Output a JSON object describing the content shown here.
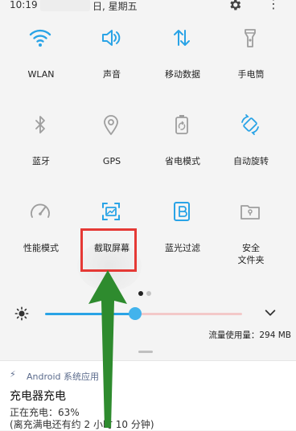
{
  "status_bar": {
    "time": "10:19",
    "date": "日, 星期五"
  },
  "tiles": [
    {
      "id": "wlan",
      "label": "WLAN",
      "icon": "wifi-icon",
      "active": true
    },
    {
      "id": "sound",
      "label": "声音",
      "icon": "speaker-icon",
      "active": true
    },
    {
      "id": "mobile-data",
      "label": "移动数据",
      "icon": "data-arrows-icon",
      "active": true
    },
    {
      "id": "flashlight",
      "label": "手电筒",
      "icon": "flashlight-icon",
      "active": false
    },
    {
      "id": "bluetooth",
      "label": "蓝牙",
      "icon": "bluetooth-icon",
      "active": false
    },
    {
      "id": "gps",
      "label": "GPS",
      "icon": "location-icon",
      "active": false
    },
    {
      "id": "power-saving",
      "label": "省电模式",
      "icon": "battery-recycle-icon",
      "active": false
    },
    {
      "id": "auto-rotate",
      "label": "自动旋转",
      "icon": "rotate-icon",
      "active": true
    },
    {
      "id": "performance",
      "label": "性能模式",
      "icon": "speedometer-icon",
      "active": false
    },
    {
      "id": "screenshot",
      "label": "截取屏幕",
      "icon": "screenshot-icon",
      "active": true
    },
    {
      "id": "blue-light",
      "label": "蓝光过滤",
      "icon": "bluelight-b-icon",
      "active": true
    },
    {
      "id": "secure-folder",
      "label": "安全\n文件夹",
      "label_line1": "安全",
      "label_line2": "文件夹",
      "icon": "secure-folder-icon",
      "active": false
    }
  ],
  "brightness": {
    "level": 0.45
  },
  "data_usage": "流量使用量：294 MB",
  "notification": {
    "app": "Android 系统应用",
    "title": "充电器充电",
    "line1": "正在充电：63%",
    "line2": "(离充满电还有约 2 小时 10 分钟)"
  },
  "colors": {
    "active": "#29a3e6",
    "inactive": "#9e9e9e",
    "highlight": "#e53935",
    "arrow": "#2e8b2e"
  }
}
